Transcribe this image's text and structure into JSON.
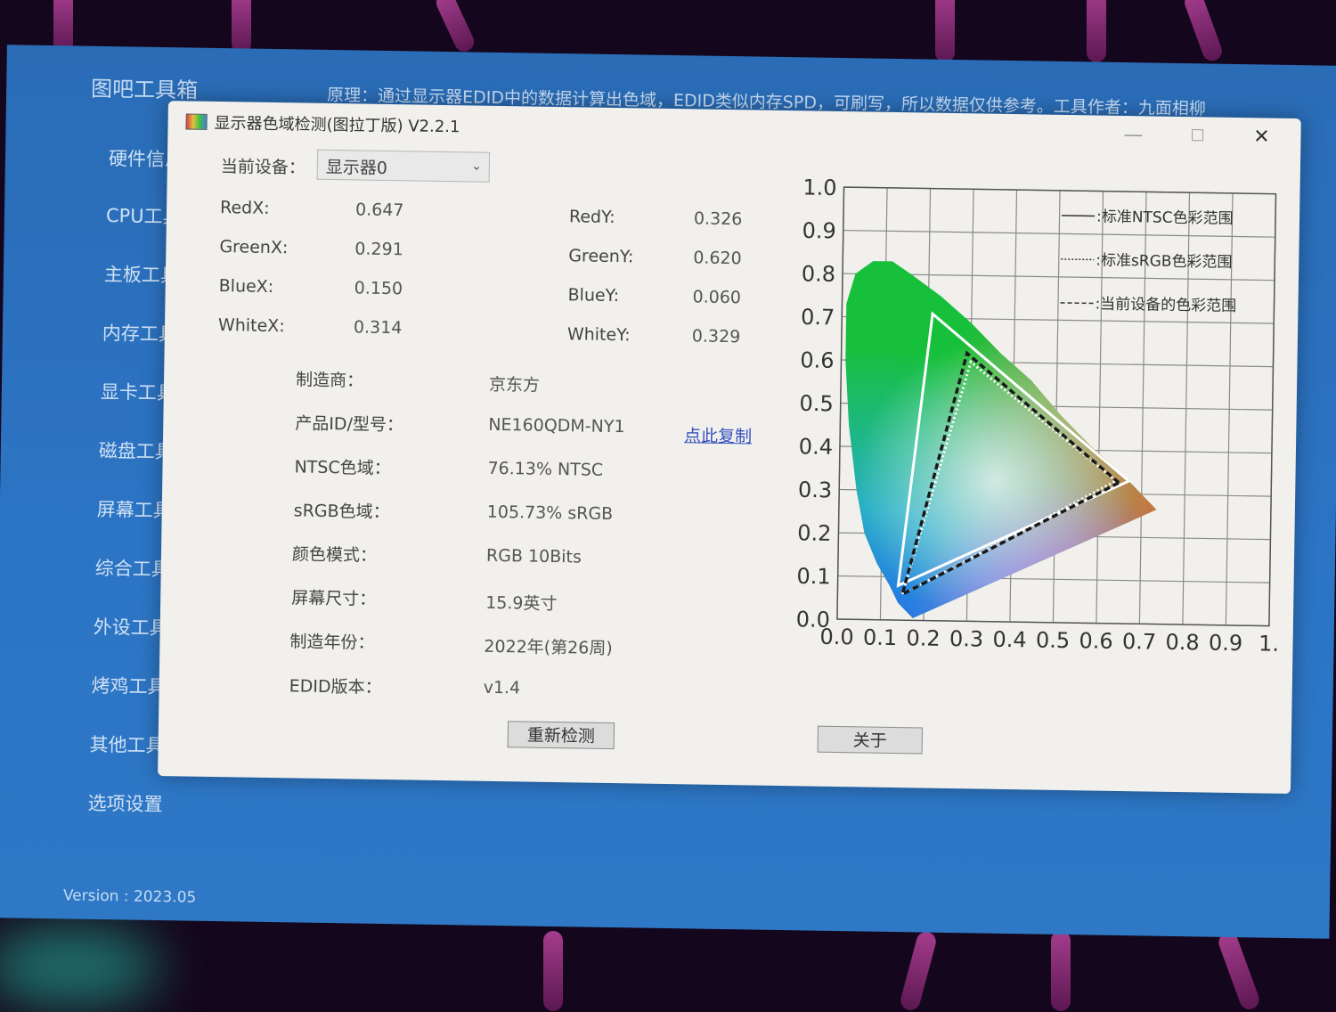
{
  "app": {
    "title": "图吧工具箱",
    "description": "原理：通过显示器EDID中的数据计算出色域，EDID类似内存SPD，可刷写，所以数据仅供参考。工具作者：九面相柳",
    "sidebar": [
      "硬件信息",
      "CPU工具",
      "主板工具",
      "内存工具",
      "显卡工具",
      "磁盘工具",
      "屏幕工具",
      "综合工具",
      "外设工具",
      "烤鸡工具",
      "其他工具",
      "选项设置"
    ],
    "version": "Version : 2023.05"
  },
  "dialog": {
    "title": "显示器色域检测(图拉丁版) V2.2.1",
    "window_buttons": {
      "minimize": "—",
      "maximize": "☐",
      "close": "✕"
    },
    "device_label": "当前设备：",
    "device_value": "显示器0",
    "coords": {
      "red_x_label": "RedX:",
      "red_x": "0.647",
      "red_y_label": "RedY:",
      "red_y": "0.326",
      "green_x_label": "GreenX:",
      "green_x": "0.291",
      "green_y_label": "GreenY:",
      "green_y": "0.620",
      "blue_x_label": "BlueX:",
      "blue_x": "0.150",
      "blue_y_label": "BlueY:",
      "blue_y": "0.060",
      "white_x_label": "WhiteX:",
      "white_x": "0.314",
      "white_y_label": "WhiteY:",
      "white_y": "0.329"
    },
    "info": [
      {
        "label": "制造商：",
        "value": "京东方"
      },
      {
        "label": "产品ID/型号：",
        "value": "NE160QDM-NY1"
      },
      {
        "label": "NTSC色域：",
        "value": "76.13% NTSC"
      },
      {
        "label": "sRGB色域：",
        "value": "105.73% sRGB"
      },
      {
        "label": "颜色模式：",
        "value": "RGB 10Bits"
      },
      {
        "label": "屏幕尺寸：",
        "value": "15.9英寸"
      },
      {
        "label": "制造年份：",
        "value": "2022年(第26周)"
      },
      {
        "label": "EDID版本：",
        "value": "v1.4"
      }
    ],
    "copy_link": "点此复制",
    "redetect_button": "重新检测",
    "about_button": "关于"
  },
  "chart_data": {
    "type": "scatter",
    "xlim": [
      0,
      1
    ],
    "ylim": [
      0,
      1
    ],
    "x_ticks": [
      "0.0",
      "0.1",
      "0.2",
      "0.3",
      "0.4",
      "0.5",
      "0.6",
      "0.7",
      "0.8",
      "0.9",
      "1."
    ],
    "y_ticks": [
      "0.0",
      "0.1",
      "0.2",
      "0.3",
      "0.4",
      "0.5",
      "0.6",
      "0.7",
      "0.8",
      "0.9",
      "1.0"
    ],
    "grid": true,
    "legend_position": "top-right",
    "legend": [
      {
        "marker": "——",
        "label": ":标准NTSC色彩范围",
        "style": "solid",
        "color": "#ffffff"
      },
      {
        "marker": "………",
        "label": ":标准sRGB色彩范围",
        "style": "dotted",
        "color": "#ffffff"
      },
      {
        "marker": "- - - -",
        "label": ":当前设备的色彩范围",
        "style": "dashed",
        "color": "#1a1a1a"
      }
    ],
    "spectral_locus": [
      [
        0.175,
        0.005
      ],
      [
        0.16,
        0.02
      ],
      [
        0.14,
        0.04
      ],
      [
        0.12,
        0.08
      ],
      [
        0.09,
        0.13
      ],
      [
        0.06,
        0.2
      ],
      [
        0.04,
        0.3
      ],
      [
        0.02,
        0.45
      ],
      [
        0.01,
        0.6
      ],
      [
        0.01,
        0.73
      ],
      [
        0.03,
        0.8
      ],
      [
        0.07,
        0.83
      ],
      [
        0.115,
        0.83
      ],
      [
        0.16,
        0.8
      ],
      [
        0.23,
        0.75
      ],
      [
        0.3,
        0.69
      ],
      [
        0.37,
        0.62
      ],
      [
        0.44,
        0.56
      ],
      [
        0.51,
        0.48
      ],
      [
        0.58,
        0.41
      ],
      [
        0.65,
        0.35
      ],
      [
        0.735,
        0.265
      ]
    ],
    "series": [
      {
        "name": "标准NTSC色彩范围",
        "points": [
          [
            0.67,
            0.33
          ],
          [
            0.21,
            0.71
          ],
          [
            0.14,
            0.08
          ]
        ]
      },
      {
        "name": "标准sRGB色彩范围",
        "points": [
          [
            0.64,
            0.33
          ],
          [
            0.3,
            0.6
          ],
          [
            0.15,
            0.06
          ]
        ]
      },
      {
        "name": "当前设备的色彩范围",
        "points": [
          [
            0.647,
            0.326
          ],
          [
            0.291,
            0.62
          ],
          [
            0.15,
            0.06
          ]
        ]
      }
    ]
  }
}
